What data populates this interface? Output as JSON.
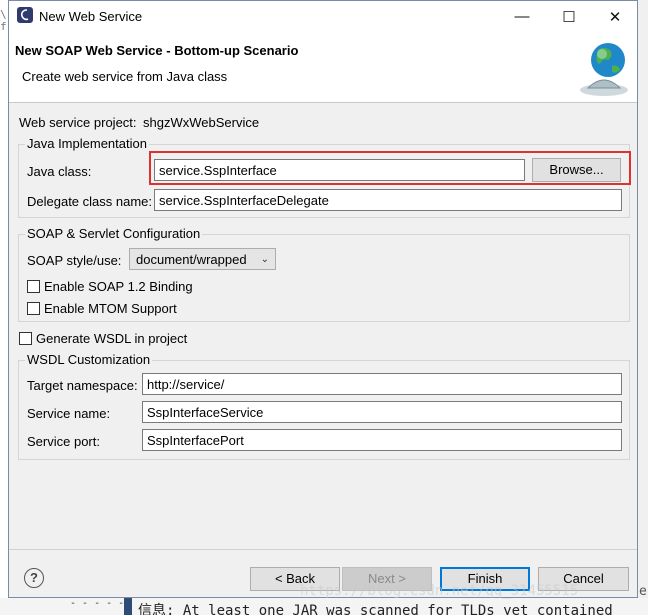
{
  "window": {
    "title": "New Web Service",
    "controls": {
      "minimize": "—",
      "maximize": "☐",
      "close": "✕"
    }
  },
  "header": {
    "title": "New SOAP Web Service - Bottom-up Scenario",
    "description": "Create web service from Java class"
  },
  "project": {
    "label": "Web service project:",
    "value": "shgzWxWebService"
  },
  "java_impl": {
    "group_title": "Java Implementation",
    "java_class_label": "Java class:",
    "java_class_value": "service.SspInterface",
    "browse_label": "Browse...",
    "delegate_label": "Delegate class name:",
    "delegate_value": "service.SspInterfaceDelegate"
  },
  "soap_config": {
    "group_title": "SOAP & Servlet Configuration",
    "style_label": "SOAP style/use:",
    "style_value": "document/wrapped",
    "soap12_label": "Enable SOAP 1.2 Binding",
    "mtom_label": "Enable MTOM Support"
  },
  "wsdl": {
    "generate_label": "Generate WSDL in project",
    "group_title": "WSDL Customization",
    "namespace_label": "Target namespace:",
    "namespace_value": "http://service/",
    "service_name_label": "Service name:",
    "service_name_value": "SspInterfaceService",
    "service_port_label": "Service port:",
    "service_port_value": "SspInterfacePort"
  },
  "footer": {
    "help": "?",
    "back_label": "< Back",
    "next_label": "Next >",
    "finish_label": "Finish",
    "cancel_label": "Cancel"
  },
  "background": {
    "console_text": "信息: At least one JAR was scanned for TLDs yet contained",
    "watermark": "https://blog.csdn.net/qq_31455515",
    "edge_text": "e"
  },
  "colors": {
    "highlight": "#e03131",
    "accent": "#0078d7"
  }
}
